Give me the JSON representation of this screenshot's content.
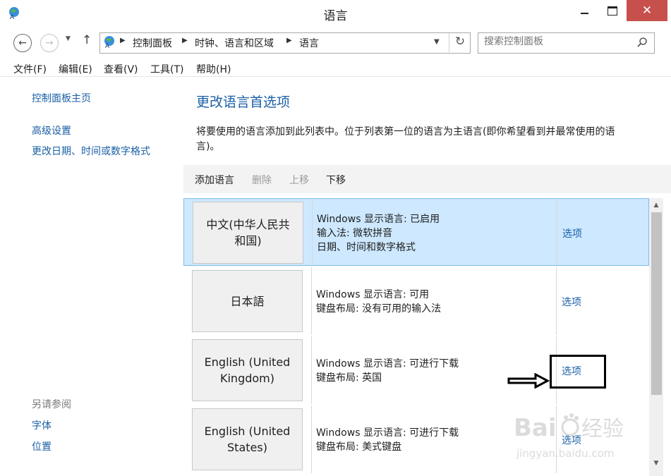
{
  "window": {
    "title": "语言"
  },
  "address": {
    "crumbs": [
      "控制面板",
      "时钟、语言和区域",
      "语言"
    ]
  },
  "search": {
    "placeholder": "搜索控制面板"
  },
  "menu": [
    "文件(F)",
    "编辑(E)",
    "查看(V)",
    "工具(T)",
    "帮助(H)"
  ],
  "left": {
    "home": "控制面板主页",
    "links": [
      "高级设置",
      "更改日期、时间或数字格式"
    ],
    "see_also_label": "另请参阅",
    "see_also": [
      "字体",
      "位置"
    ]
  },
  "main": {
    "title": "更改语言首选项",
    "desc_line1": "将要使用的语言添加到此列表中。位于列表第一位的语言为主语言(即你希望看到并最常使用的语",
    "desc_line2": "言)。",
    "toolbar": {
      "add": "添加语言",
      "remove": "删除",
      "up": "上移",
      "down": "下移"
    },
    "languages": [
      {
        "name_l1": "中文(中华人民共",
        "name_l2": "和国)",
        "info": [
          "Windows 显示语言: 已启用",
          "输入法: 微软拼音",
          "日期、时间和数字格式"
        ],
        "option": "选项"
      },
      {
        "name_l1": "日本語",
        "name_l2": "",
        "info": [
          "Windows 显示语言: 可用",
          "键盘布局: 没有可用的输入法"
        ],
        "option": "选项"
      },
      {
        "name_l1": "English (United",
        "name_l2": "Kingdom)",
        "info": [
          "Windows 显示语言: 可进行下载",
          "键盘布局: 英国"
        ],
        "option": "选项"
      },
      {
        "name_l1": "English (United",
        "name_l2": "States)",
        "info": [
          "Windows 显示语言: 可进行下载",
          "键盘布局: 美式键盘"
        ],
        "option": "选项"
      }
    ]
  },
  "watermark": {
    "brand": "Baidu经验",
    "url": "jingyan.baidu.com"
  },
  "colors": {
    "link": "#1a5fa6",
    "selected_row": "#cde8ff",
    "close_button": "#c7504d"
  }
}
